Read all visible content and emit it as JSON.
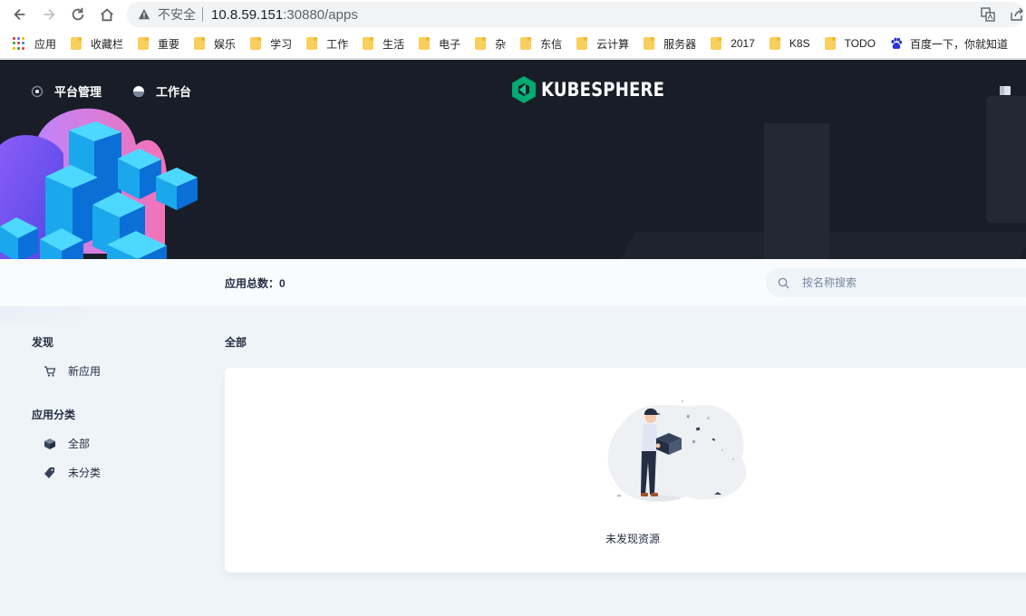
{
  "browser": {
    "insecure_label": "不安全",
    "url_host": "10.8.59.151",
    "url_path": ":30880/apps"
  },
  "bookmarks": [
    {
      "label": "应用",
      "icon": "apps-grid-icon"
    },
    {
      "label": "收藏栏",
      "icon": "folder-icon"
    },
    {
      "label": "重要",
      "icon": "folder-icon"
    },
    {
      "label": "娱乐",
      "icon": "folder-icon"
    },
    {
      "label": "学习",
      "icon": "folder-icon"
    },
    {
      "label": "工作",
      "icon": "folder-icon"
    },
    {
      "label": "生活",
      "icon": "folder-icon"
    },
    {
      "label": "电子",
      "icon": "folder-icon"
    },
    {
      "label": "杂",
      "icon": "folder-icon"
    },
    {
      "label": "东信",
      "icon": "folder-icon"
    },
    {
      "label": "云计算",
      "icon": "folder-icon"
    },
    {
      "label": "服务器",
      "icon": "folder-icon"
    },
    {
      "label": "2017",
      "icon": "folder-icon"
    },
    {
      "label": "K8S",
      "icon": "folder-icon"
    },
    {
      "label": "TODO",
      "icon": "folder-icon"
    },
    {
      "label": "百度一下，你就知道",
      "icon": "baidu-paw-icon"
    }
  ],
  "header": {
    "nav_platform": "平台管理",
    "nav_workbench": "工作台",
    "logo_text": "KUBESPHERE"
  },
  "toolbar": {
    "count_label": "应用总数：",
    "count_value": "0",
    "search_placeholder": "按名称搜索"
  },
  "sidebar": {
    "discover_title": "发现",
    "new_apps": "新应用",
    "category_title": "应用分类",
    "all": "全部",
    "uncategorized": "未分类"
  },
  "main": {
    "section_title": "全部",
    "empty_text": "未发现资源"
  },
  "colors": {
    "header_bg": "#181d28",
    "brand_green": "#00aa72",
    "page_bg": "#eff4f9"
  }
}
